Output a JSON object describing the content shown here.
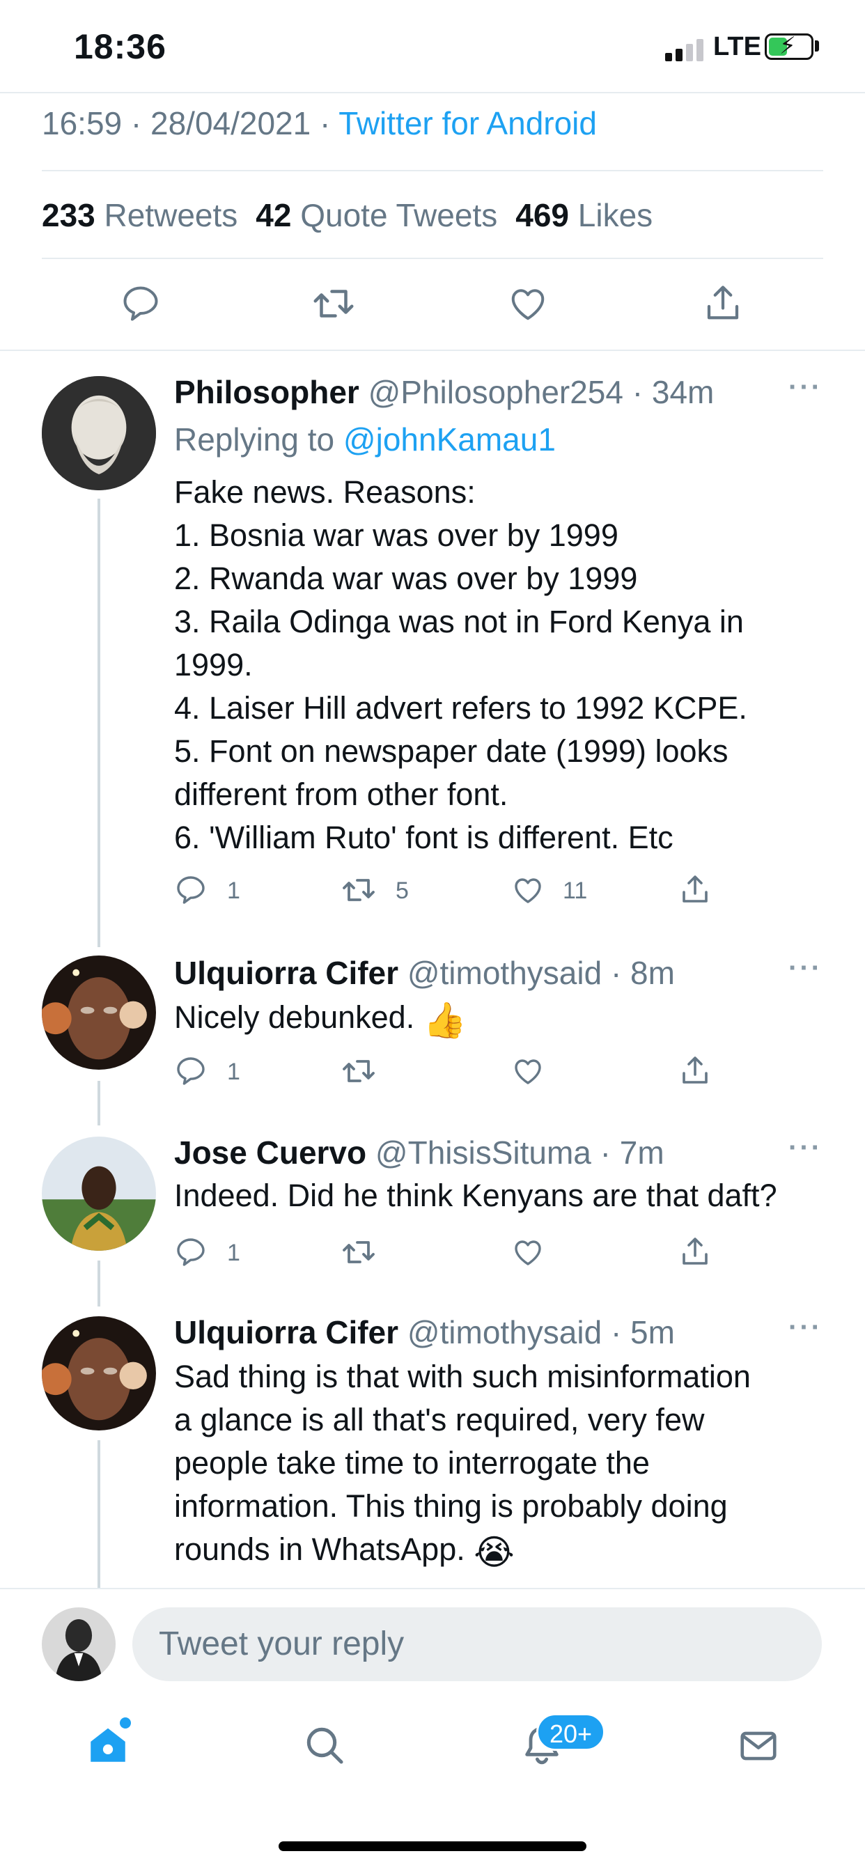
{
  "status_bar": {
    "time": "18:36",
    "network": "LTE"
  },
  "tweet": {
    "timestamp": "16:59 · 28/04/2021 · ",
    "source": "Twitter for Android",
    "stats": {
      "retweets_count": "233",
      "retweets_label": "Retweets",
      "quotes_count": "42",
      "quotes_label": "Quote Tweets",
      "likes_count": "469",
      "likes_label": "Likes"
    }
  },
  "replies": [
    {
      "name": "Philosopher",
      "handle": "@Philosopher254 · 34m",
      "replying_prefix": "Replying to ",
      "replying_to": "@johnKamau1",
      "lines": [
        "Fake news. Reasons:",
        "1. Bosnia war was over by 1999",
        "2. Rwanda war was over by 1999",
        "3. Raila Odinga was not in Ford Kenya in",
        "1999.",
        "4. Laiser Hill advert refers to 1992 KCPE.",
        "5. Font on newspaper date (1999) looks",
        "different from other font.",
        "6. 'William Ruto' font is different. Etc"
      ],
      "reply_count": "1",
      "retweet_count": "5",
      "like_count": "11"
    },
    {
      "name": "Ulquiorra Cifer",
      "handle": "@timothysaid · 8m",
      "text": "Nicely debunked. ",
      "emoji": "👍",
      "reply_count": "1"
    },
    {
      "name": "Jose Cuervo",
      "handle": "@ThisisSituma · 7m",
      "text": "Indeed. Did he think Kenyans are that daft?",
      "reply_count": "1"
    },
    {
      "name": "Ulquiorra Cifer",
      "handle": "@timothysaid · 5m",
      "lines": [
        "Sad thing is that with such misinformation",
        "a glance is all that's required, very few",
        "people take time to interrogate the",
        "information. This thing is probably doing",
        "rounds in WhatsApp. "
      ],
      "emoji": "😭"
    }
  ],
  "composer": {
    "placeholder": "Tweet your reply"
  },
  "tabbar": {
    "notifications_badge": "20+"
  },
  "more_glyph": "···",
  "colors": {
    "accent": "#1da1f2",
    "secondary_text": "#657786",
    "divider": "#e6ecf0"
  },
  "icons": [
    "reply-icon",
    "retweet-icon",
    "like-icon",
    "share-icon",
    "home-icon",
    "search-icon",
    "notifications-icon",
    "messages-icon"
  ]
}
